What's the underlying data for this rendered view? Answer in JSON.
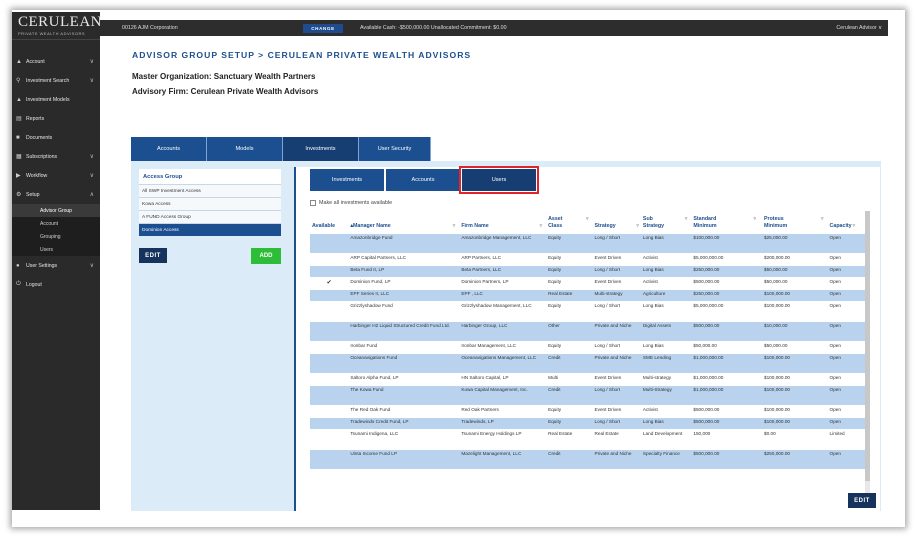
{
  "sidebar": {
    "logo": "CERULEAN",
    "logo_sub": "PRIVATE WEALTH ADVISORS",
    "menu_icon": "hamburger-icon",
    "items": [
      {
        "label": "Account",
        "icon": "home-icon",
        "chevron": true
      },
      {
        "label": "Investment Search",
        "icon": "search-icon",
        "chevron": true
      },
      {
        "label": "Investment Models",
        "icon": "model-icon",
        "chevron": false
      },
      {
        "label": "Reports",
        "icon": "chart-icon",
        "chevron": false
      },
      {
        "label": "Documents",
        "icon": "document-icon",
        "chevron": false
      },
      {
        "label": "Subscriptions",
        "icon": "subscription-icon",
        "chevron": true
      },
      {
        "label": "Workflow",
        "icon": "workflow-icon",
        "chevron": true
      },
      {
        "label": "Setup",
        "icon": "setup-icon",
        "chevron": true
      }
    ],
    "setup_subitems": [
      {
        "label": "Advisor Group",
        "active": true
      },
      {
        "label": "Account",
        "active": false
      },
      {
        "label": "Grouping",
        "active": false
      },
      {
        "label": "Users",
        "active": false
      }
    ],
    "bottom_items": [
      {
        "label": "User Settings",
        "icon": "user-icon",
        "chevron": true
      },
      {
        "label": "Logout",
        "icon": "logout-icon",
        "chevron": false
      }
    ]
  },
  "topbar": {
    "org": "00126 AJM Corporation",
    "change": "CHANGE",
    "cash": "Available Cash: -$500,000.00    Unallocated Commitment: $0.00",
    "user": "Cerulean Advisor ∨"
  },
  "page": {
    "title": "ADVISOR GROUP SETUP > CERULEAN PRIVATE WEALTH ADVISORS",
    "master_org": "Master Organization: Sanctuary Wealth Partners",
    "advisory_firm": "Advisory Firm: Cerulean Private Wealth Advisors"
  },
  "main_tabs": [
    {
      "label": "Accounts",
      "active": false
    },
    {
      "label": "Models",
      "active": false
    },
    {
      "label": "Investments",
      "active": true
    },
    {
      "label": "User Security",
      "active": false
    }
  ],
  "access_group": {
    "title": "Access Group",
    "items": [
      {
        "label": "All SWP Investment Access",
        "selected": false
      },
      {
        "label": "Kowa Access",
        "selected": false
      },
      {
        "label": "A FUND Access Group",
        "selected": false
      },
      {
        "label": "Dominion Access",
        "selected": true
      }
    ],
    "edit": "EDIT",
    "add": "ADD"
  },
  "sub_tabs": [
    {
      "label": "Investments",
      "active": false
    },
    {
      "label": "Accounts",
      "active": false
    },
    {
      "label": "Users",
      "active": true
    }
  ],
  "make_all_label": "Make all investments available",
  "table": {
    "columns": [
      "Available",
      "Manager Name",
      "Firm Name",
      "Asset Class",
      "Strategy",
      "Sub Strategy",
      "Standard Minimum",
      "Proteus Minimum",
      "Capacity"
    ],
    "rows": [
      {
        "available": "",
        "manager": "Amazonbridge Fund",
        "firm": "Amazonbridge Management, LLC",
        "asset": "Equity",
        "strategy": "Long / Short",
        "sub": "Long Bias",
        "std": "$100,000.00",
        "prot": "$25,000.00",
        "cap": "Open"
      },
      {
        "available": "",
        "manager": "ARP Capital Partners, LLC",
        "firm": "ARP Partners, LLC",
        "asset": "Equity",
        "strategy": "Event Driven",
        "sub": "Activist",
        "std": "$5,000,000.00",
        "prot": "$200,000.00",
        "cap": "Open"
      },
      {
        "available": "",
        "manager": "Beta Fund II, LP",
        "firm": "Beta Partners, LLC",
        "asset": "Equity",
        "strategy": "Long / Short",
        "sub": "Long Bias",
        "std": "$250,000.00",
        "prot": "$50,000.00",
        "cap": "Open"
      },
      {
        "available": "✔",
        "manager": "Dominion Fund, LP",
        "firm": "Dominion Partners, LP",
        "asset": "Equity",
        "strategy": "Event Driven",
        "sub": "Activist",
        "std": "$500,000.00",
        "prot": "$50,000.00",
        "cap": "Open"
      },
      {
        "available": "",
        "manager": "EPF Series II, LLC",
        "firm": "EPF , LLC",
        "asset": "Real Estate",
        "strategy": "Multi-strategy",
        "sub": "Agriculture",
        "std": "$250,000.00",
        "prot": "$100,000.00",
        "cap": "Open"
      },
      {
        "available": "",
        "manager": "Grizzlyshadow Fund",
        "firm": "Grizzlyshadow Management, LLC",
        "asset": "Equity",
        "strategy": "Long / Short",
        "sub": "Long Bias",
        "std": "$5,000,000.00",
        "prot": "$100,000.00",
        "cap": "Open"
      },
      {
        "available": "",
        "manager": "Harbinger H2 Liquid Structured Credit Fund Ltd.",
        "firm": "Harbinger Group, LLC",
        "asset": "Other",
        "strategy": "Private and Niche",
        "sub": "Digital Assets",
        "std": "$500,000.00",
        "prot": "$10,000.00",
        "cap": "Open"
      },
      {
        "available": "",
        "manager": "Ironbar Fund",
        "firm": "Ironbar Management, LLC",
        "asset": "Equity",
        "strategy": "Long / Short",
        "sub": "Long Bias",
        "std": "$50,000.00",
        "prot": "$50,000.00",
        "cap": "Open"
      },
      {
        "available": "",
        "manager": "Oceanavigations Fund",
        "firm": "Oceanavigations Management, LLC",
        "asset": "Credit",
        "strategy": "Private and Niche",
        "sub": "SME Lending",
        "std": "$1,000,000.00",
        "prot": "$100,000.00",
        "cap": "Open"
      },
      {
        "available": "",
        "manager": "Saltoro Alpha Fund, LP",
        "firm": "HN Saltoro Capital, LP",
        "asset": "Multi",
        "strategy": "Event Driven",
        "sub": "Multi-strategy",
        "std": "$1,000,000.00",
        "prot": "$100,000.00",
        "cap": "Open"
      },
      {
        "available": "",
        "manager": "The Kowa Fund",
        "firm": "Kowa Capital Management, Inc.",
        "asset": "Credit",
        "strategy": "Long / Short",
        "sub": "Multi-Strategy",
        "std": "$1,000,000.00",
        "prot": "$100,000.00",
        "cap": "Open"
      },
      {
        "available": "",
        "manager": "The Red Oak Fund",
        "firm": "Red Oak Partners",
        "asset": "Equity",
        "strategy": "Event Driven",
        "sub": "Activist",
        "std": "$500,000.00",
        "prot": "$100,000.00",
        "cap": "Open"
      },
      {
        "available": "",
        "manager": "Tradewinds Credit Fund, LP",
        "firm": "Tradewinds, LP",
        "asset": "Equity",
        "strategy": "Long / Short",
        "sub": "Long Bias",
        "std": "$500,000.00",
        "prot": "$100,000.00",
        "cap": "Open"
      },
      {
        "available": "",
        "manager": "Tsunami Indigena, LLC",
        "firm": "Tsunami Energy Holdings LP",
        "asset": "Real Estate",
        "strategy": "Real Estate",
        "sub": "Land Development",
        "std": "150,000",
        "prot": "$0.00",
        "cap": "Limited"
      },
      {
        "available": "",
        "manager": "Uinta Income Fund LP",
        "firm": "Mazelight Management, LLC",
        "asset": "Credit",
        "strategy": "Private and Niche",
        "sub": "Specialty Finance",
        "std": "$500,000.00",
        "prot": "$250,000.00",
        "cap": "Open"
      }
    ]
  },
  "bottom_edit": "EDIT"
}
